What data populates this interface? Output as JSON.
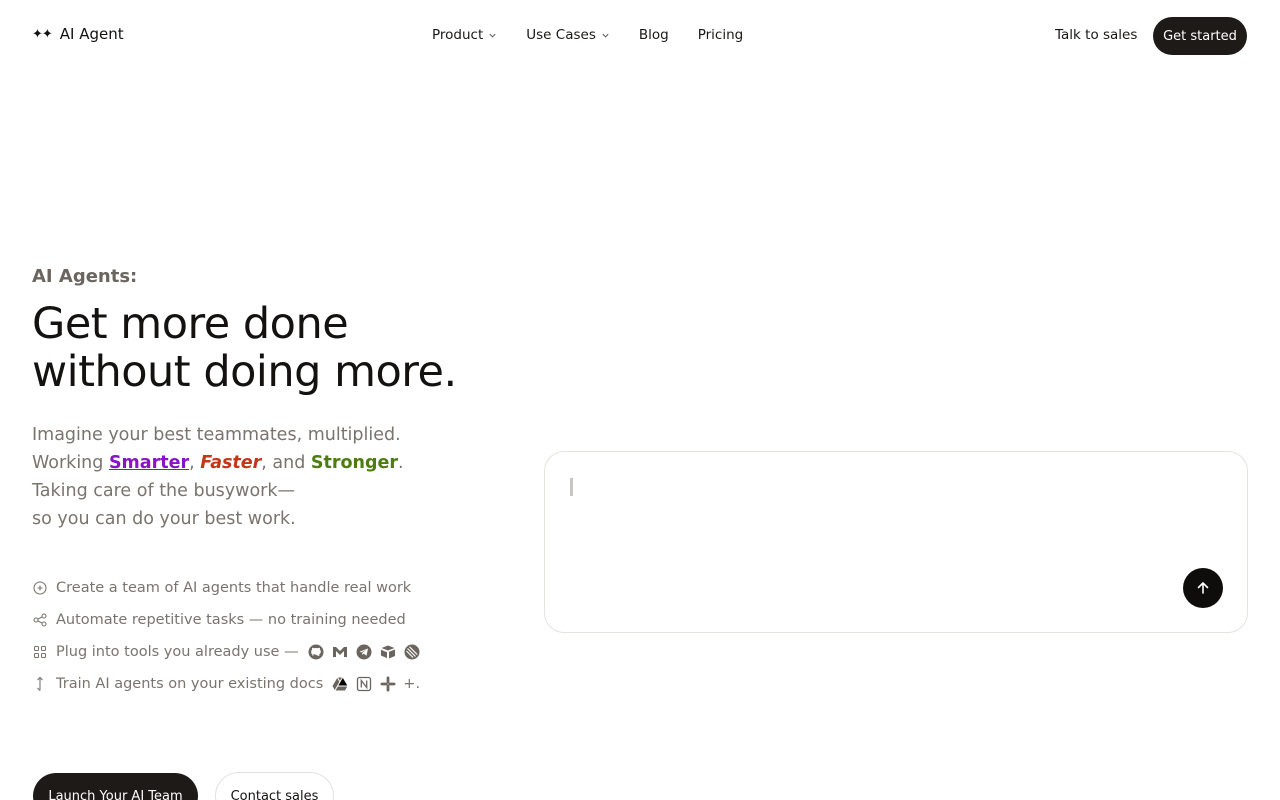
{
  "header": {
    "logo_text": "AI Agent",
    "logo_mark": "✦✦",
    "nav": [
      {
        "label": "Product",
        "has_dropdown": true
      },
      {
        "label": "Use Cases",
        "has_dropdown": true
      },
      {
        "label": "Blog",
        "has_dropdown": false
      },
      {
        "label": "Pricing",
        "has_dropdown": false
      }
    ],
    "talk_to_sales": "Talk to sales",
    "get_started": "Get started"
  },
  "hero": {
    "eyebrow": "AI Agents:",
    "headline_line1": "Get more done",
    "headline_line2": "without doing more.",
    "sub_line1": "Imagine your best teammates, multiplied.",
    "sub_working": "Working ",
    "sub_smarter": "Smarter",
    "sub_comma1": ", ",
    "sub_faster": "Faster",
    "sub_and": ", and ",
    "sub_stronger": "Stronger",
    "sub_period": ".",
    "sub_line3": "Taking care of the busywork—",
    "sub_line4": "so you can do your best work."
  },
  "features": [
    {
      "icon": "plus-circle-icon",
      "text": "Create a team of AI agents that handle real work"
    },
    {
      "icon": "share-icon",
      "text": "Automate repetitive tasks — no training needed"
    },
    {
      "icon": "grid-icon",
      "text": "Plug into tools you already use —",
      "tools": [
        "github-icon",
        "gmail-icon",
        "telegram-icon",
        "airtable-icon",
        "linear-icon"
      ]
    },
    {
      "icon": "arrow-vertical-icon",
      "text": "Train AI agents on your existing docs",
      "tools": [
        "google-drive-icon",
        "notion-icon",
        "slack-icon"
      ],
      "suffix": "+."
    }
  ],
  "cta": {
    "primary": "Launch Your AI Team",
    "secondary": "Contact sales"
  },
  "prompt": {
    "placeholder": "",
    "send_icon": "arrow-up-icon"
  },
  "colors": {
    "dark": "#1e1a17",
    "smarter": "#8a12c9",
    "faster": "#c53616",
    "stronger": "#4d7d12",
    "muted": "#7a746e"
  }
}
